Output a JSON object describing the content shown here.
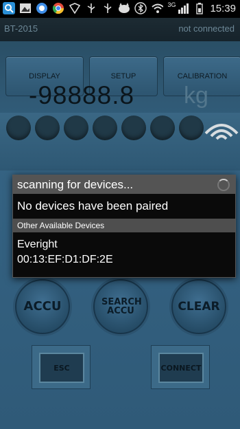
{
  "status_bar": {
    "network": "3G",
    "time": "15:39",
    "icons": [
      "search-icon",
      "gallery-icon",
      "messenger-icon",
      "chrome-icon",
      "vpn-shield-icon",
      "usb-icon",
      "usb-icon",
      "cat-icon",
      "bluetooth-icon",
      "wifi-icon",
      "signal-icon",
      "battery-icon"
    ]
  },
  "header": {
    "app_name": "BT-2015",
    "connection_status": "not connected"
  },
  "tabs": [
    "DISPLAY",
    "SETUP",
    "CALIBRATION"
  ],
  "readout": {
    "value": "-98888.8",
    "unit": "kg",
    "led_count": 7
  },
  "buttons": {
    "accu": "ACCU",
    "search_accu": "SEARCH ACCU",
    "clear": "CLEAR",
    "esc": "ESC",
    "connect": "CONNECT"
  },
  "dialog": {
    "title": "scanning for devices...",
    "paired_message": "No devices have been paired",
    "section_header": "Other Available Devices",
    "devices": [
      {
        "name": "Everight",
        "address": "00:13:EF:D1:DF:2E"
      }
    ]
  },
  "colors": {
    "app_background": "#356383",
    "dialog_title": "#545454",
    "dialog_body": "#0a0a0a"
  }
}
